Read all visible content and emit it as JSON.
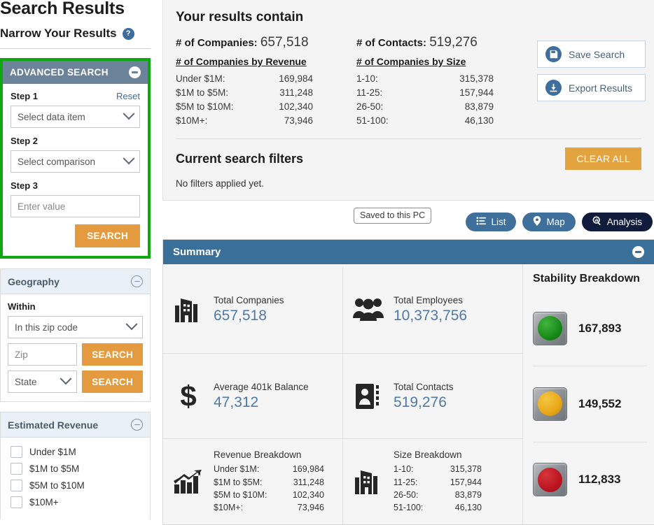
{
  "sidebar": {
    "page_title": "Search Results",
    "narrow_title": "Narrow Your Results",
    "help_icon_glyph": "?",
    "advanced_search": {
      "header": "ADVANCED SEARCH",
      "collapse_icon": "minus-circle-icon",
      "reset_label": "Reset",
      "step1_label": "Step 1",
      "step1_value": "Select data item",
      "step2_label": "Step 2",
      "step2_value": "Select comparison",
      "step3_label": "Step 3",
      "step3_placeholder": "Enter value",
      "search_label": "SEARCH",
      "highlight_color": "#0ea80e",
      "header_color": "#6b8299"
    },
    "geography": {
      "header": "Geography",
      "within_label": "Within",
      "within_value": "In this zip code",
      "zip_placeholder": "Zip",
      "zip_search_label": "SEARCH",
      "state_value": "State",
      "state_search_label": "SEARCH"
    },
    "estimated_revenue": {
      "header": "Estimated Revenue",
      "options": [
        {
          "label": "Under $1M",
          "checked": false
        },
        {
          "label": "$1M to $5M",
          "checked": false
        },
        {
          "label": "$5M to $10M",
          "checked": false
        },
        {
          "label": "$10M+",
          "checked": false
        }
      ]
    }
  },
  "results": {
    "headline": "Your results contain",
    "companies_label": "# of Companies:",
    "companies_value": "657,518",
    "contacts_label": "# of Contacts:",
    "contacts_value": "519,276",
    "by_revenue_heading": "# of Companies by Revenue",
    "by_revenue": [
      {
        "label": "Under $1M:",
        "value": "169,984"
      },
      {
        "label": "$1M to $5M:",
        "value": "311,248"
      },
      {
        "label": "$5M to $10M:",
        "value": "102,340"
      },
      {
        "label": "$10M+:",
        "value": "73,946"
      }
    ],
    "by_size_heading": "# of Companies by Size",
    "by_size": [
      {
        "label": "1-10:",
        "value": "315,378"
      },
      {
        "label": "11-25:",
        "value": "157,944"
      },
      {
        "label": "26-50:",
        "value": "83,879"
      },
      {
        "label": "51-100:",
        "value": "46,130"
      }
    ],
    "save_search_label": "Save Search",
    "save_search_icon": "floppy-disk-icon",
    "export_results_label": "Export Results",
    "export_results_icon": "download-icon",
    "filters_title": "Current search filters",
    "clear_all_label": "CLEAR ALL",
    "no_filters_text": "No filters applied yet."
  },
  "view_tabs": [
    {
      "label": "List",
      "icon": "list-icon",
      "active": false
    },
    {
      "label": "Map",
      "icon": "map-pin-icon",
      "active": false
    },
    {
      "label": "Analysis",
      "icon": "analysis-search-icon",
      "active": true
    }
  ],
  "summary": {
    "header": "Summary",
    "collapse_icon": "minus-circle-icon",
    "header_color": "#3a6f9a",
    "metrics": [
      {
        "icon": "building-icon",
        "label": "Total Companies",
        "value": "657,518"
      },
      {
        "icon": "people-icon",
        "label": "Total Employees",
        "value": "10,373,756"
      },
      {
        "icon": "dollar-icon",
        "label": "Average 401k Balance",
        "value": "47,312"
      },
      {
        "icon": "contact-card-icon",
        "label": "Total Contacts",
        "value": "519,276"
      }
    ],
    "revenue_breakdown": {
      "icon": "growth-chart-icon",
      "label": "Revenue Breakdown",
      "rows": [
        {
          "label": "Under $1M:",
          "value": "169,984"
        },
        {
          "label": "$1M to $5M:",
          "value": "311,248"
        },
        {
          "label": "$5M to $10M:",
          "value": "102,340"
        },
        {
          "label": "$10M+:",
          "value": "73,946"
        }
      ]
    },
    "size_breakdown": {
      "icon": "building-icon",
      "label": "Size Breakdown",
      "rows": [
        {
          "label": "1-10:",
          "value": "315,378"
        },
        {
          "label": "11-25:",
          "value": "157,944"
        },
        {
          "label": "26-50:",
          "value": "83,879"
        },
        {
          "label": "51-100:",
          "value": "46,130"
        }
      ]
    },
    "stability": {
      "title": "Stability Breakdown",
      "rows": [
        {
          "light": "green",
          "color": "#168a18",
          "value": "167,893"
        },
        {
          "light": "amber",
          "color": "#e8a818",
          "value": "149,552"
        },
        {
          "light": "red",
          "color": "#bb1421",
          "value": "112,833"
        }
      ]
    }
  },
  "overlay": {
    "saved_tooltip": "Saved to this PC"
  }
}
